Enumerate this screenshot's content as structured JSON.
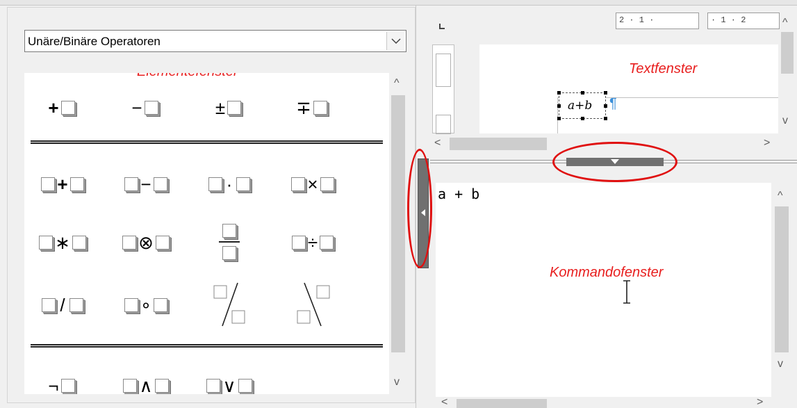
{
  "elements_panel": {
    "category_select": {
      "value": "Unäre/Binäre Operatoren"
    },
    "label": "Elementefenster",
    "groups": [
      {
        "symbols": [
          {
            "name": "plus-a",
            "pre": "",
            "op": "+",
            "post": "box"
          },
          {
            "name": "minus-a",
            "pre": "",
            "op": "−",
            "post": "box"
          },
          {
            "name": "plusminus-a",
            "pre": "",
            "op": "±",
            "post": "box"
          },
          {
            "name": "minusplus-a",
            "pre": "",
            "op": "∓",
            "post": "box"
          }
        ]
      },
      {
        "symbols": [
          {
            "name": "a-plus-b",
            "op": "+"
          },
          {
            "name": "a-minus-b",
            "op": "−"
          },
          {
            "name": "a-cdot-b",
            "op": "·"
          },
          {
            "name": "a-times-b",
            "op": "×"
          },
          {
            "name": "a-star-b",
            "op": "∗"
          },
          {
            "name": "a-otimes-b",
            "op": "⊗"
          },
          {
            "name": "frac-a-b",
            "op": ""
          },
          {
            "name": "a-div-b",
            "op": "÷"
          },
          {
            "name": "a-slash-b",
            "op": "/"
          },
          {
            "name": "a-circ-b",
            "op": "∘"
          },
          {
            "name": "wideslash-a-b",
            "op": ""
          },
          {
            "name": "widebslash-a-b",
            "op": ""
          }
        ]
      },
      {
        "symbols": [
          {
            "name": "neg-a",
            "op": "¬"
          },
          {
            "name": "a-and-b",
            "op": "∧"
          },
          {
            "name": "a-or-b",
            "op": "∨"
          }
        ]
      }
    ]
  },
  "text_window": {
    "label": "Textfenster",
    "ruler": [
      "2 · 1 ·",
      "· 1 · 2"
    ],
    "formula": "a+b",
    "paragraph_mark": "¶"
  },
  "command_window": {
    "label": "Kommandofenster",
    "content": "a + b"
  },
  "colors": {
    "annotation_red": "#e01010",
    "splitter": "#707070"
  },
  "icons": [
    "chevron-down-icon",
    "scroll-up-icon",
    "scroll-down-icon",
    "scroll-left-icon",
    "scroll-right-icon",
    "text-cursor-icon"
  ]
}
